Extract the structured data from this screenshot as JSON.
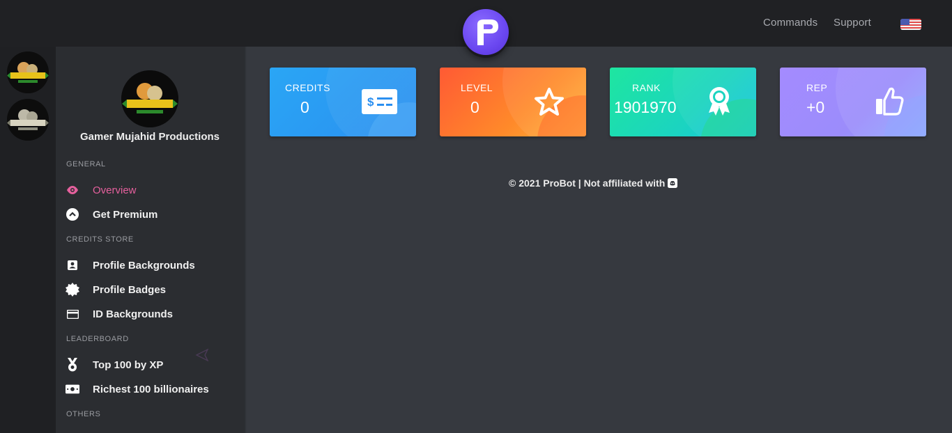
{
  "header": {
    "nav": [
      {
        "label": "Commands"
      },
      {
        "label": "Support"
      }
    ]
  },
  "sidebar": {
    "guild_name": "Gamer Mujahid Productions",
    "sections": {
      "general": "GENERAL",
      "credits_store": "CREDITS STORE",
      "leaderboard": "LEADERBOARD",
      "others": "OTHERS"
    },
    "items": {
      "overview": "Overview",
      "get_premium": "Get Premium",
      "profile_backgrounds": "Profile Backgrounds",
      "profile_badges": "Profile Badges",
      "id_backgrounds": "ID Backgrounds",
      "top_100_xp": "Top 100 by XP",
      "richest_100": "Richest 100 billionaires"
    },
    "active_color": "#e5609d"
  },
  "stats": {
    "credits": {
      "label": "CREDITS",
      "value": "0"
    },
    "level": {
      "label": "LEVEL",
      "value": "0"
    },
    "rank": {
      "label": "RANK",
      "value": "1901970"
    },
    "rep": {
      "label": "REP",
      "value": "+0"
    }
  },
  "footer": {
    "text": "© 2021 ProBot | Not affiliated with"
  },
  "colors": {
    "brand": "#6a47f0",
    "credits": "#2b8ff0",
    "level": "#ff7a2e",
    "rank": "#1bd4c0",
    "rep": "#9b8cfb"
  }
}
